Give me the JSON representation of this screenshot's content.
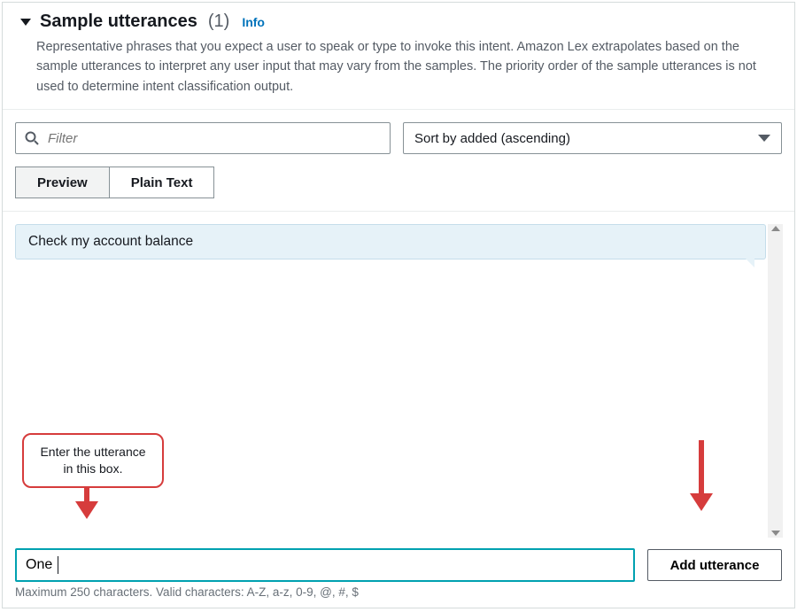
{
  "header": {
    "title": "Sample utterances",
    "count": "(1)",
    "info_label": "Info",
    "description": "Representative phrases that you expect a user to speak or type to invoke this intent. Amazon Lex extrapolates based on the sample utterances to interpret any user input that may vary from the samples. The priority order of the sample utterances is not used to determine intent classification output."
  },
  "filters": {
    "filter_placeholder": "Filter",
    "sort_label": "Sort by added (ascending)"
  },
  "tabs": {
    "preview": "Preview",
    "plain_text": "Plain Text"
  },
  "utterances": [
    "Check my account balance"
  ],
  "input": {
    "value": "One",
    "add_button": "Add utterance",
    "helper": "Maximum 250 characters. Valid characters: A-Z, a-z, 0-9, @, #, $"
  },
  "annotation": {
    "callout_text": "Enter the utterance in this box."
  }
}
